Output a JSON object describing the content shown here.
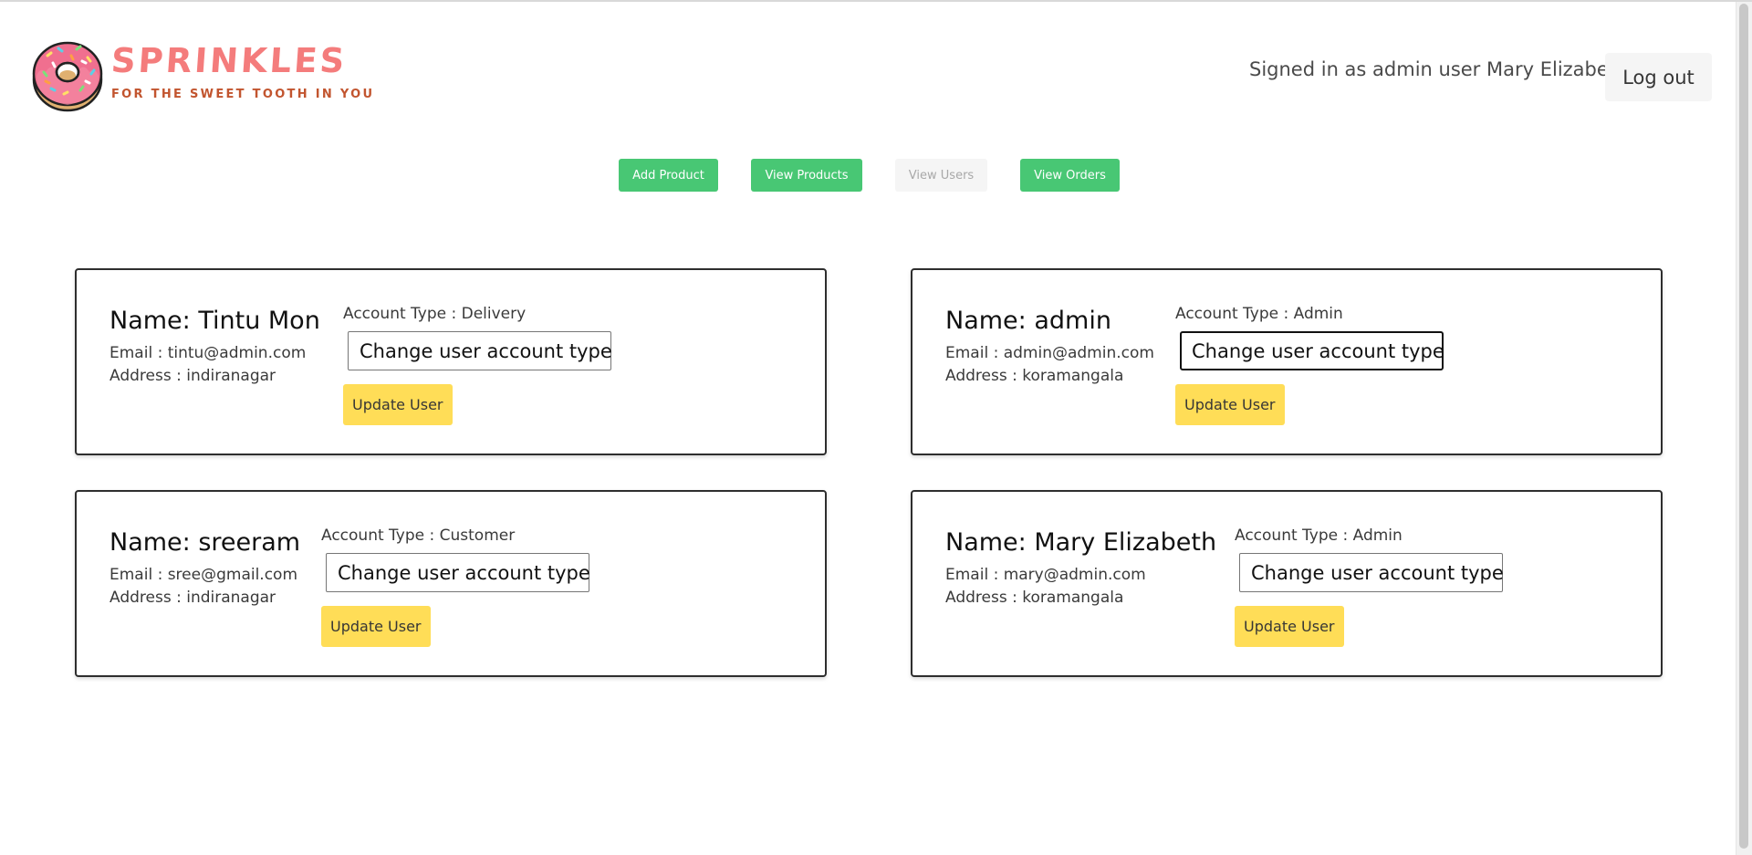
{
  "header": {
    "brand_name": "SPRINKLES",
    "tagline": "FOR THE SWEET TOOTH IN YOU",
    "signed_in_text": "Signed in as admin user Mary Elizabeth",
    "logout_label": "Log out"
  },
  "nav": {
    "add_product": "Add Product",
    "view_products": "View Products",
    "view_users": "View Users",
    "view_orders": "View Orders"
  },
  "users": [
    {
      "name": "Name: Tintu Mon",
      "email": "Email : tintu@admin.com",
      "address": "Address : indiranagar",
      "account_type": "Account Type : Delivery",
      "select_value": "Change user account type",
      "update_label": "Update User"
    },
    {
      "name": "Name: admin",
      "email": "Email : admin@admin.com",
      "address": "Address : koramangala",
      "account_type": "Account Type : Admin",
      "select_value": "Change user account type",
      "update_label": "Update User"
    },
    {
      "name": "Name: sreeram",
      "email": "Email : sree@gmail.com",
      "address": "Address : indiranagar",
      "account_type": "Account Type : Customer",
      "select_value": "Change user account type",
      "update_label": "Update User"
    },
    {
      "name": "Name: Mary Elizabeth",
      "email": "Email : mary@admin.com",
      "address": "Address : koramangala",
      "account_type": "Account Type : Admin",
      "select_value": "Change user account type",
      "update_label": "Update User"
    }
  ],
  "colors": {
    "primary_green": "#48c774",
    "warning_yellow": "#ffdd57",
    "brand_pink": "#f47c7c",
    "tagline_orange": "#c2552f"
  },
  "icons": {
    "logo": "donut-logo-icon",
    "select_arrow": "chevron-down-icon"
  }
}
